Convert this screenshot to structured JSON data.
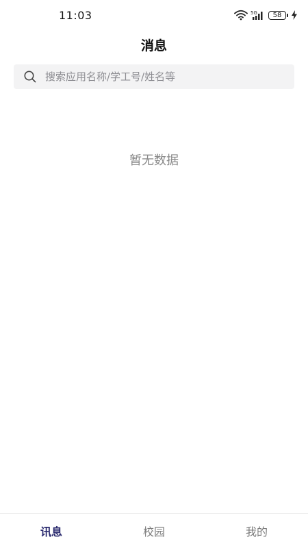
{
  "status_bar": {
    "time": "11:03",
    "network": "5G",
    "battery": "58"
  },
  "header": {
    "title": "消息"
  },
  "search": {
    "placeholder": "搜索应用名称/学工号/姓名等",
    "value": ""
  },
  "main": {
    "empty_text": "暂无数据"
  },
  "tabs": [
    {
      "label": "讯息",
      "active": true
    },
    {
      "label": "校园",
      "active": false
    },
    {
      "label": "我的",
      "active": false
    }
  ],
  "colors": {
    "active_tab": "#2a2a6e",
    "inactive_tab": "#7a7a7a",
    "search_bg": "#f3f3f4",
    "empty_text": "#8a8a8a"
  }
}
